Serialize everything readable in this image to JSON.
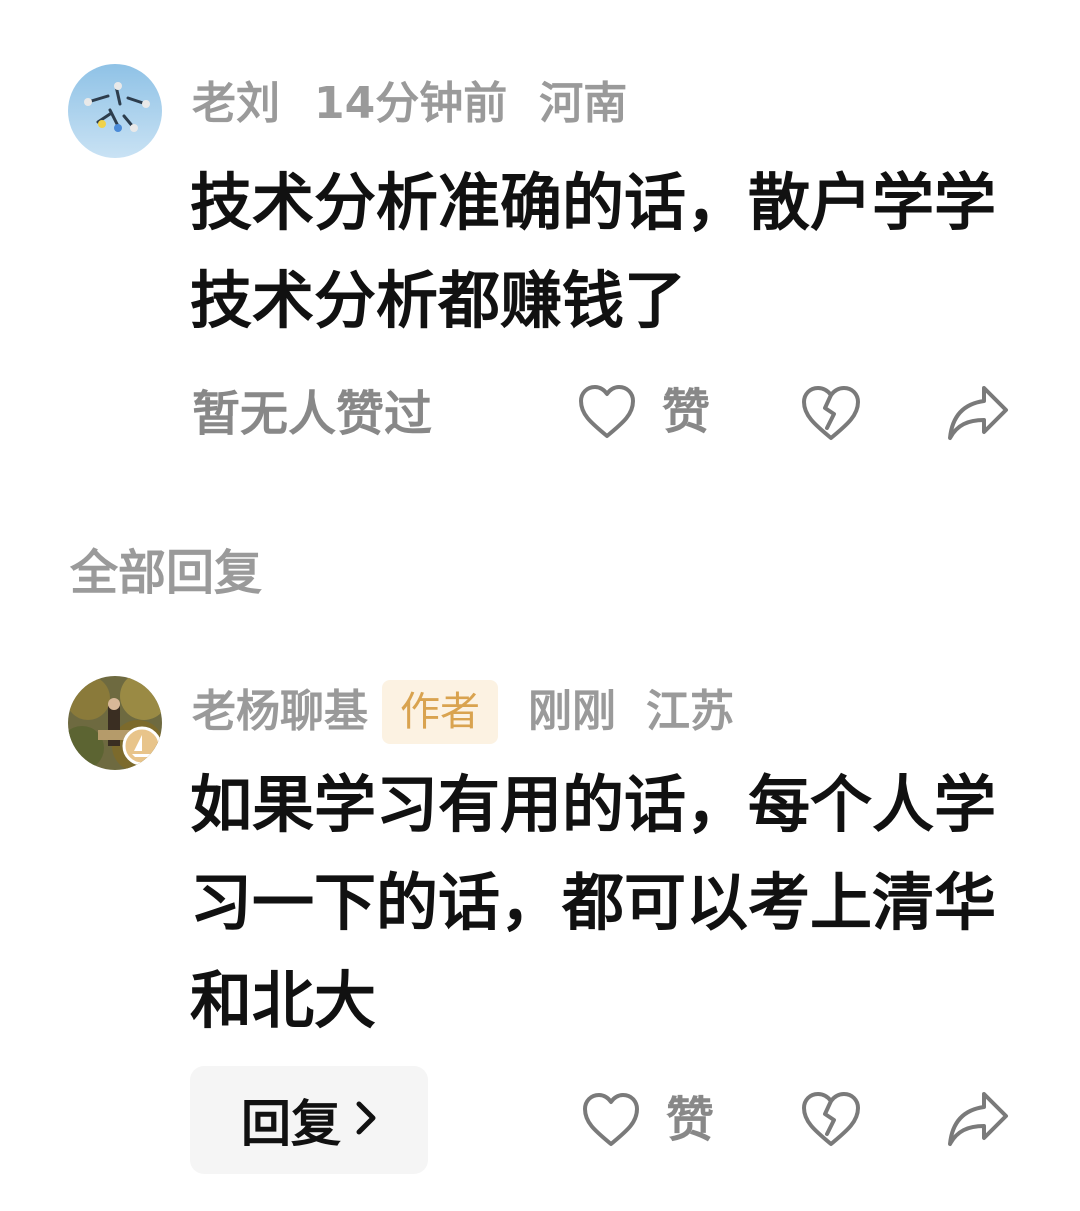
{
  "comment": {
    "username": "老刘",
    "time": "14分钟前",
    "location": "河南",
    "text": "技术分析准确的话，散户学学技术分析都赚钱了",
    "likes_status": "暂无人赞过",
    "like_label": "赞",
    "avatar_icon": "skydivers-avatar",
    "like_icon": "heart-outline-icon",
    "dislike_icon": "broken-heart-icon",
    "share_icon": "share-arrow-icon"
  },
  "replies_section": {
    "title": "全部回复"
  },
  "reply": {
    "username": "老杨聊基",
    "badge": "作者",
    "time": "刚刚",
    "location": "江苏",
    "text": "如果学习有用的话，每个人学习一下的话，都可以考上清华和北大",
    "reply_button_label": "回复",
    "like_label": "赞",
    "avatar_icon": "forest-portrait-avatar",
    "badge_icon": "sailboat-badge-icon",
    "like_icon": "heart-outline-icon",
    "dislike_icon": "broken-heart-icon",
    "share_icon": "share-arrow-icon"
  },
  "colors": {
    "meta_text": "#9a9a9a",
    "content_text": "#111111",
    "author_badge_bg": "#fcf2e2",
    "author_badge_text": "#d9a34f",
    "reply_button_bg": "#f5f5f5"
  }
}
